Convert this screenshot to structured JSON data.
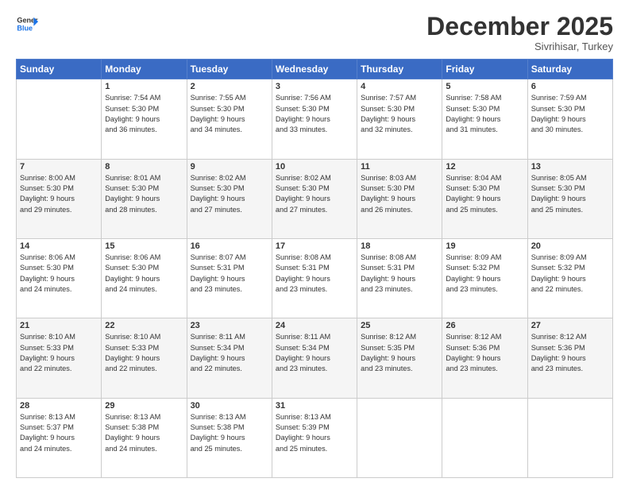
{
  "logo": {
    "line1": "General",
    "line2": "Blue"
  },
  "title": "December 2025",
  "subtitle": "Sivrihisar, Turkey",
  "days_header": [
    "Sunday",
    "Monday",
    "Tuesday",
    "Wednesday",
    "Thursday",
    "Friday",
    "Saturday"
  ],
  "weeks": [
    [
      {
        "num": "",
        "info": ""
      },
      {
        "num": "1",
        "info": "Sunrise: 7:54 AM\nSunset: 5:30 PM\nDaylight: 9 hours\nand 36 minutes."
      },
      {
        "num": "2",
        "info": "Sunrise: 7:55 AM\nSunset: 5:30 PM\nDaylight: 9 hours\nand 34 minutes."
      },
      {
        "num": "3",
        "info": "Sunrise: 7:56 AM\nSunset: 5:30 PM\nDaylight: 9 hours\nand 33 minutes."
      },
      {
        "num": "4",
        "info": "Sunrise: 7:57 AM\nSunset: 5:30 PM\nDaylight: 9 hours\nand 32 minutes."
      },
      {
        "num": "5",
        "info": "Sunrise: 7:58 AM\nSunset: 5:30 PM\nDaylight: 9 hours\nand 31 minutes."
      },
      {
        "num": "6",
        "info": "Sunrise: 7:59 AM\nSunset: 5:30 PM\nDaylight: 9 hours\nand 30 minutes."
      }
    ],
    [
      {
        "num": "7",
        "info": "Sunrise: 8:00 AM\nSunset: 5:30 PM\nDaylight: 9 hours\nand 29 minutes."
      },
      {
        "num": "8",
        "info": "Sunrise: 8:01 AM\nSunset: 5:30 PM\nDaylight: 9 hours\nand 28 minutes."
      },
      {
        "num": "9",
        "info": "Sunrise: 8:02 AM\nSunset: 5:30 PM\nDaylight: 9 hours\nand 27 minutes."
      },
      {
        "num": "10",
        "info": "Sunrise: 8:02 AM\nSunset: 5:30 PM\nDaylight: 9 hours\nand 27 minutes."
      },
      {
        "num": "11",
        "info": "Sunrise: 8:03 AM\nSunset: 5:30 PM\nDaylight: 9 hours\nand 26 minutes."
      },
      {
        "num": "12",
        "info": "Sunrise: 8:04 AM\nSunset: 5:30 PM\nDaylight: 9 hours\nand 25 minutes."
      },
      {
        "num": "13",
        "info": "Sunrise: 8:05 AM\nSunset: 5:30 PM\nDaylight: 9 hours\nand 25 minutes."
      }
    ],
    [
      {
        "num": "14",
        "info": "Sunrise: 8:06 AM\nSunset: 5:30 PM\nDaylight: 9 hours\nand 24 minutes."
      },
      {
        "num": "15",
        "info": "Sunrise: 8:06 AM\nSunset: 5:30 PM\nDaylight: 9 hours\nand 24 minutes."
      },
      {
        "num": "16",
        "info": "Sunrise: 8:07 AM\nSunset: 5:31 PM\nDaylight: 9 hours\nand 23 minutes."
      },
      {
        "num": "17",
        "info": "Sunrise: 8:08 AM\nSunset: 5:31 PM\nDaylight: 9 hours\nand 23 minutes."
      },
      {
        "num": "18",
        "info": "Sunrise: 8:08 AM\nSunset: 5:31 PM\nDaylight: 9 hours\nand 23 minutes."
      },
      {
        "num": "19",
        "info": "Sunrise: 8:09 AM\nSunset: 5:32 PM\nDaylight: 9 hours\nand 23 minutes."
      },
      {
        "num": "20",
        "info": "Sunrise: 8:09 AM\nSunset: 5:32 PM\nDaylight: 9 hours\nand 22 minutes."
      }
    ],
    [
      {
        "num": "21",
        "info": "Sunrise: 8:10 AM\nSunset: 5:33 PM\nDaylight: 9 hours\nand 22 minutes."
      },
      {
        "num": "22",
        "info": "Sunrise: 8:10 AM\nSunset: 5:33 PM\nDaylight: 9 hours\nand 22 minutes."
      },
      {
        "num": "23",
        "info": "Sunrise: 8:11 AM\nSunset: 5:34 PM\nDaylight: 9 hours\nand 22 minutes."
      },
      {
        "num": "24",
        "info": "Sunrise: 8:11 AM\nSunset: 5:34 PM\nDaylight: 9 hours\nand 23 minutes."
      },
      {
        "num": "25",
        "info": "Sunrise: 8:12 AM\nSunset: 5:35 PM\nDaylight: 9 hours\nand 23 minutes."
      },
      {
        "num": "26",
        "info": "Sunrise: 8:12 AM\nSunset: 5:36 PM\nDaylight: 9 hours\nand 23 minutes."
      },
      {
        "num": "27",
        "info": "Sunrise: 8:12 AM\nSunset: 5:36 PM\nDaylight: 9 hours\nand 23 minutes."
      }
    ],
    [
      {
        "num": "28",
        "info": "Sunrise: 8:13 AM\nSunset: 5:37 PM\nDaylight: 9 hours\nand 24 minutes."
      },
      {
        "num": "29",
        "info": "Sunrise: 8:13 AM\nSunset: 5:38 PM\nDaylight: 9 hours\nand 24 minutes."
      },
      {
        "num": "30",
        "info": "Sunrise: 8:13 AM\nSunset: 5:38 PM\nDaylight: 9 hours\nand 25 minutes."
      },
      {
        "num": "31",
        "info": "Sunrise: 8:13 AM\nSunset: 5:39 PM\nDaylight: 9 hours\nand 25 minutes."
      },
      {
        "num": "",
        "info": ""
      },
      {
        "num": "",
        "info": ""
      },
      {
        "num": "",
        "info": ""
      }
    ]
  ]
}
